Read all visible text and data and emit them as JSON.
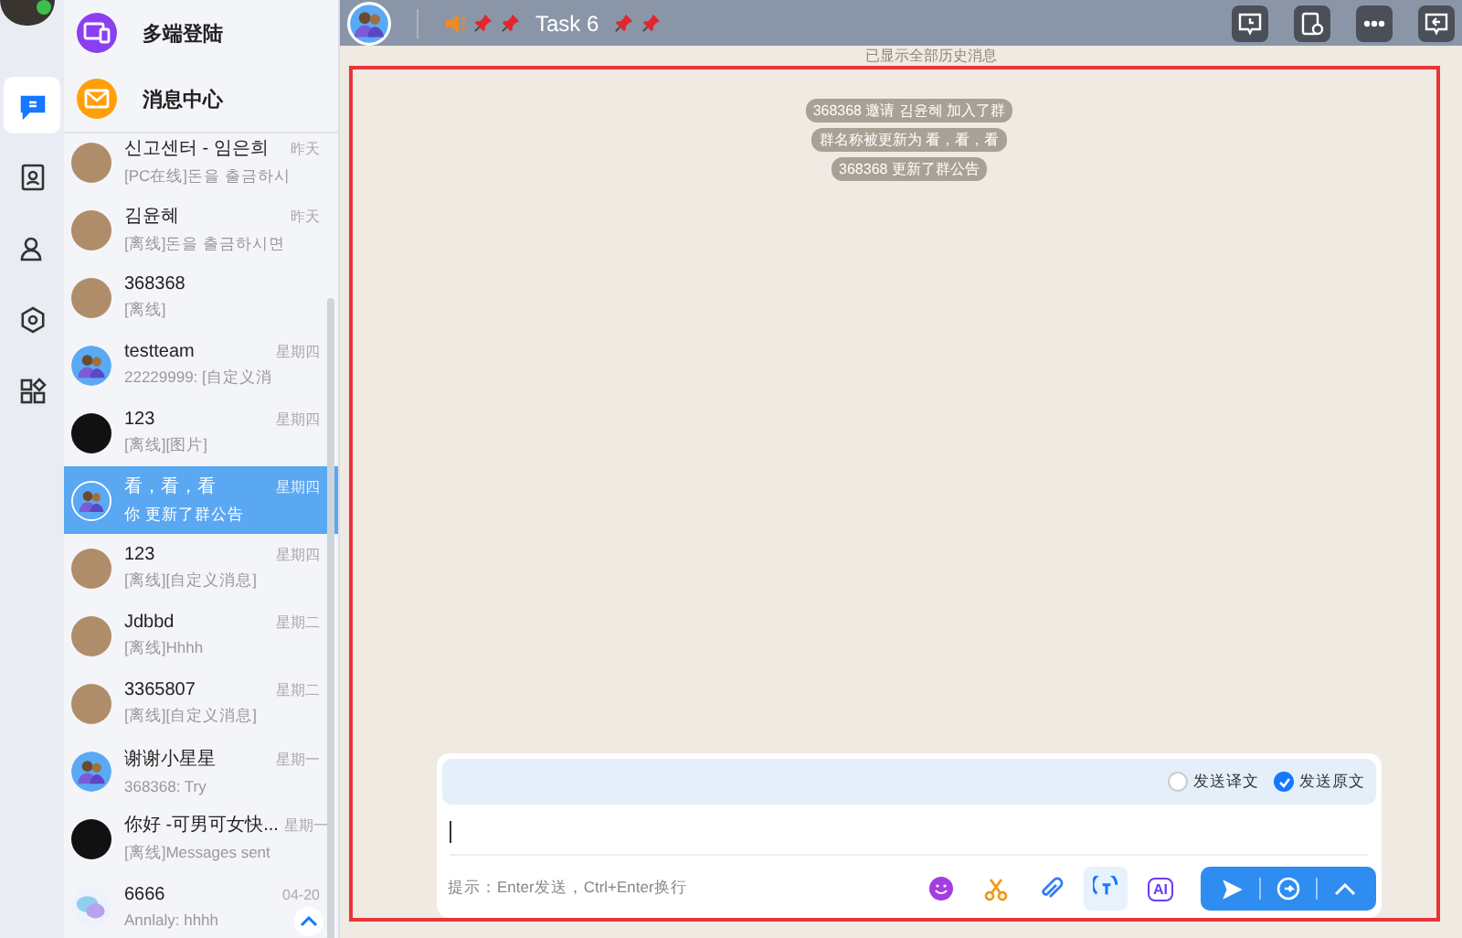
{
  "rail": {
    "status_online": true,
    "items": [
      {
        "kind": "chat",
        "selected": true
      },
      {
        "kind": "contacts",
        "selected": false
      },
      {
        "kind": "person",
        "selected": false
      },
      {
        "kind": "settings",
        "selected": false
      },
      {
        "kind": "apps",
        "selected": false
      }
    ]
  },
  "shortcuts": [
    {
      "kind": "devices",
      "label": "多端登陆"
    },
    {
      "kind": "mail",
      "label": "消息中心"
    }
  ],
  "conversations": [
    {
      "name": "신고센터 - 임은희",
      "preview": "[PC在线]돈을 출금하시",
      "time": "昨天",
      "kind": "photo",
      "selected": false
    },
    {
      "name": "김윤혜",
      "preview": "[离线]돈을 출금하시면",
      "time": "昨天",
      "kind": "photo",
      "selected": false
    },
    {
      "name": "368368",
      "preview": "[离线]",
      "kind": "photo",
      "selected": false
    },
    {
      "name": "testteam",
      "preview": "22229999: [自定义消",
      "time": "星期四",
      "kind": "group",
      "selected": false
    },
    {
      "name": "123",
      "preview": "[离线][图片]",
      "time": "星期四",
      "kind": "dark",
      "selected": false
    },
    {
      "name": "看，看，看",
      "preview": "你 更新了群公告",
      "time": "星期四",
      "kind": "group",
      "selected": true
    },
    {
      "name": "123",
      "preview": "[离线][自定义消息]",
      "time": "星期四",
      "kind": "photo",
      "selected": false
    },
    {
      "name": "Jdbbd",
      "preview": "[离线]Hhhh",
      "time": "星期二",
      "kind": "photo",
      "selected": false
    },
    {
      "name": "3365807",
      "preview": "[离线][自定义消息]",
      "time": "星期二",
      "kind": "photo",
      "selected": false
    },
    {
      "name": "谢谢小星星",
      "preview": "368368: Try",
      "time": "星期一",
      "kind": "group",
      "selected": false
    },
    {
      "name": "你好 -可男可女快...",
      "preview": "[离线]Messages sent",
      "time": "星期一",
      "kind": "dark",
      "selected": false
    },
    {
      "name": "6666",
      "preview": "Annlaly: hhhh",
      "time": "04-20",
      "kind": "bubble",
      "selected": false
    }
  ],
  "header": {
    "title": "Task 6",
    "actions": [
      {
        "kind": "history"
      },
      {
        "kind": "schedule"
      },
      {
        "kind": "more"
      },
      {
        "kind": "reply"
      }
    ]
  },
  "chat": {
    "history_note": "已显示全部历史消息",
    "notices": [
      "368368 邀请 김윤혜 加入了群",
      "群名称被更新为 看，看，看",
      "368368 更新了群公告"
    ]
  },
  "composer": {
    "options": [
      {
        "label": "发送译文",
        "checked": false
      },
      {
        "label": "发送原文",
        "checked": true
      }
    ],
    "hint": "提示：Enter发送，Ctrl+Enter换行",
    "tools": [
      {
        "kind": "emoji",
        "selected": false
      },
      {
        "kind": "scissors",
        "selected": false
      },
      {
        "kind": "clip",
        "selected": false
      },
      {
        "kind": "translate",
        "selected": true
      },
      {
        "kind": "ai",
        "label": "AI",
        "selected": false
      }
    ]
  }
}
